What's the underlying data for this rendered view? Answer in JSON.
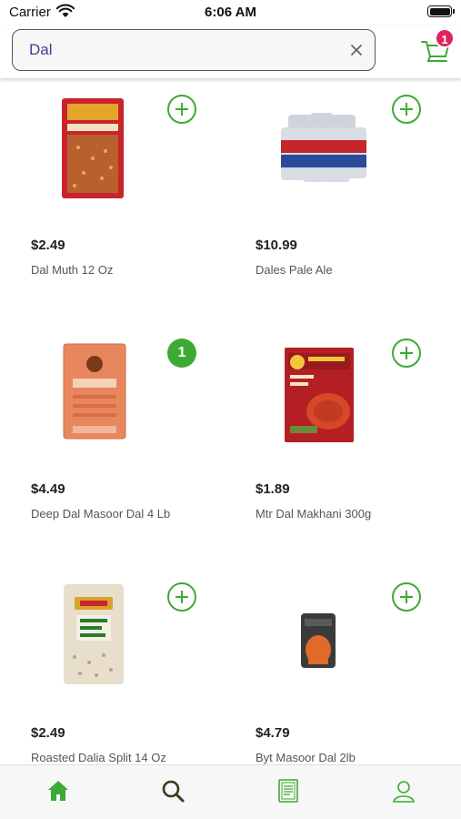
{
  "status_bar": {
    "carrier": "Carrier",
    "time": "6:06 AM"
  },
  "search": {
    "value": "Dal",
    "placeholder": ""
  },
  "cart": {
    "count": "1",
    "badge_color": "#e0245e"
  },
  "accent_color": "#3daa35",
  "products": [
    {
      "price": "$2.49",
      "name": "Dal Muth 12 Oz",
      "in_cart": null
    },
    {
      "price": "$10.99",
      "name": "Dales Pale Ale",
      "in_cart": null
    },
    {
      "price": "$4.49",
      "name": "Deep Dal Masoor Dal 4 Lb",
      "in_cart": "1"
    },
    {
      "price": "$1.89",
      "name": "Mtr Dal Makhani 300g",
      "in_cart": null
    },
    {
      "price": "$2.49",
      "name": "Roasted Dalia Split 14 Oz",
      "in_cart": null
    },
    {
      "price": "$4.79",
      "name": "Byt Masoor Dal 2lb",
      "in_cart": null
    }
  ],
  "tabs": [
    {
      "icon": "home-icon",
      "active": true
    },
    {
      "icon": "search-icon",
      "active": false
    },
    {
      "icon": "orders-list-icon",
      "active": false
    },
    {
      "icon": "profile-icon",
      "active": false
    }
  ]
}
